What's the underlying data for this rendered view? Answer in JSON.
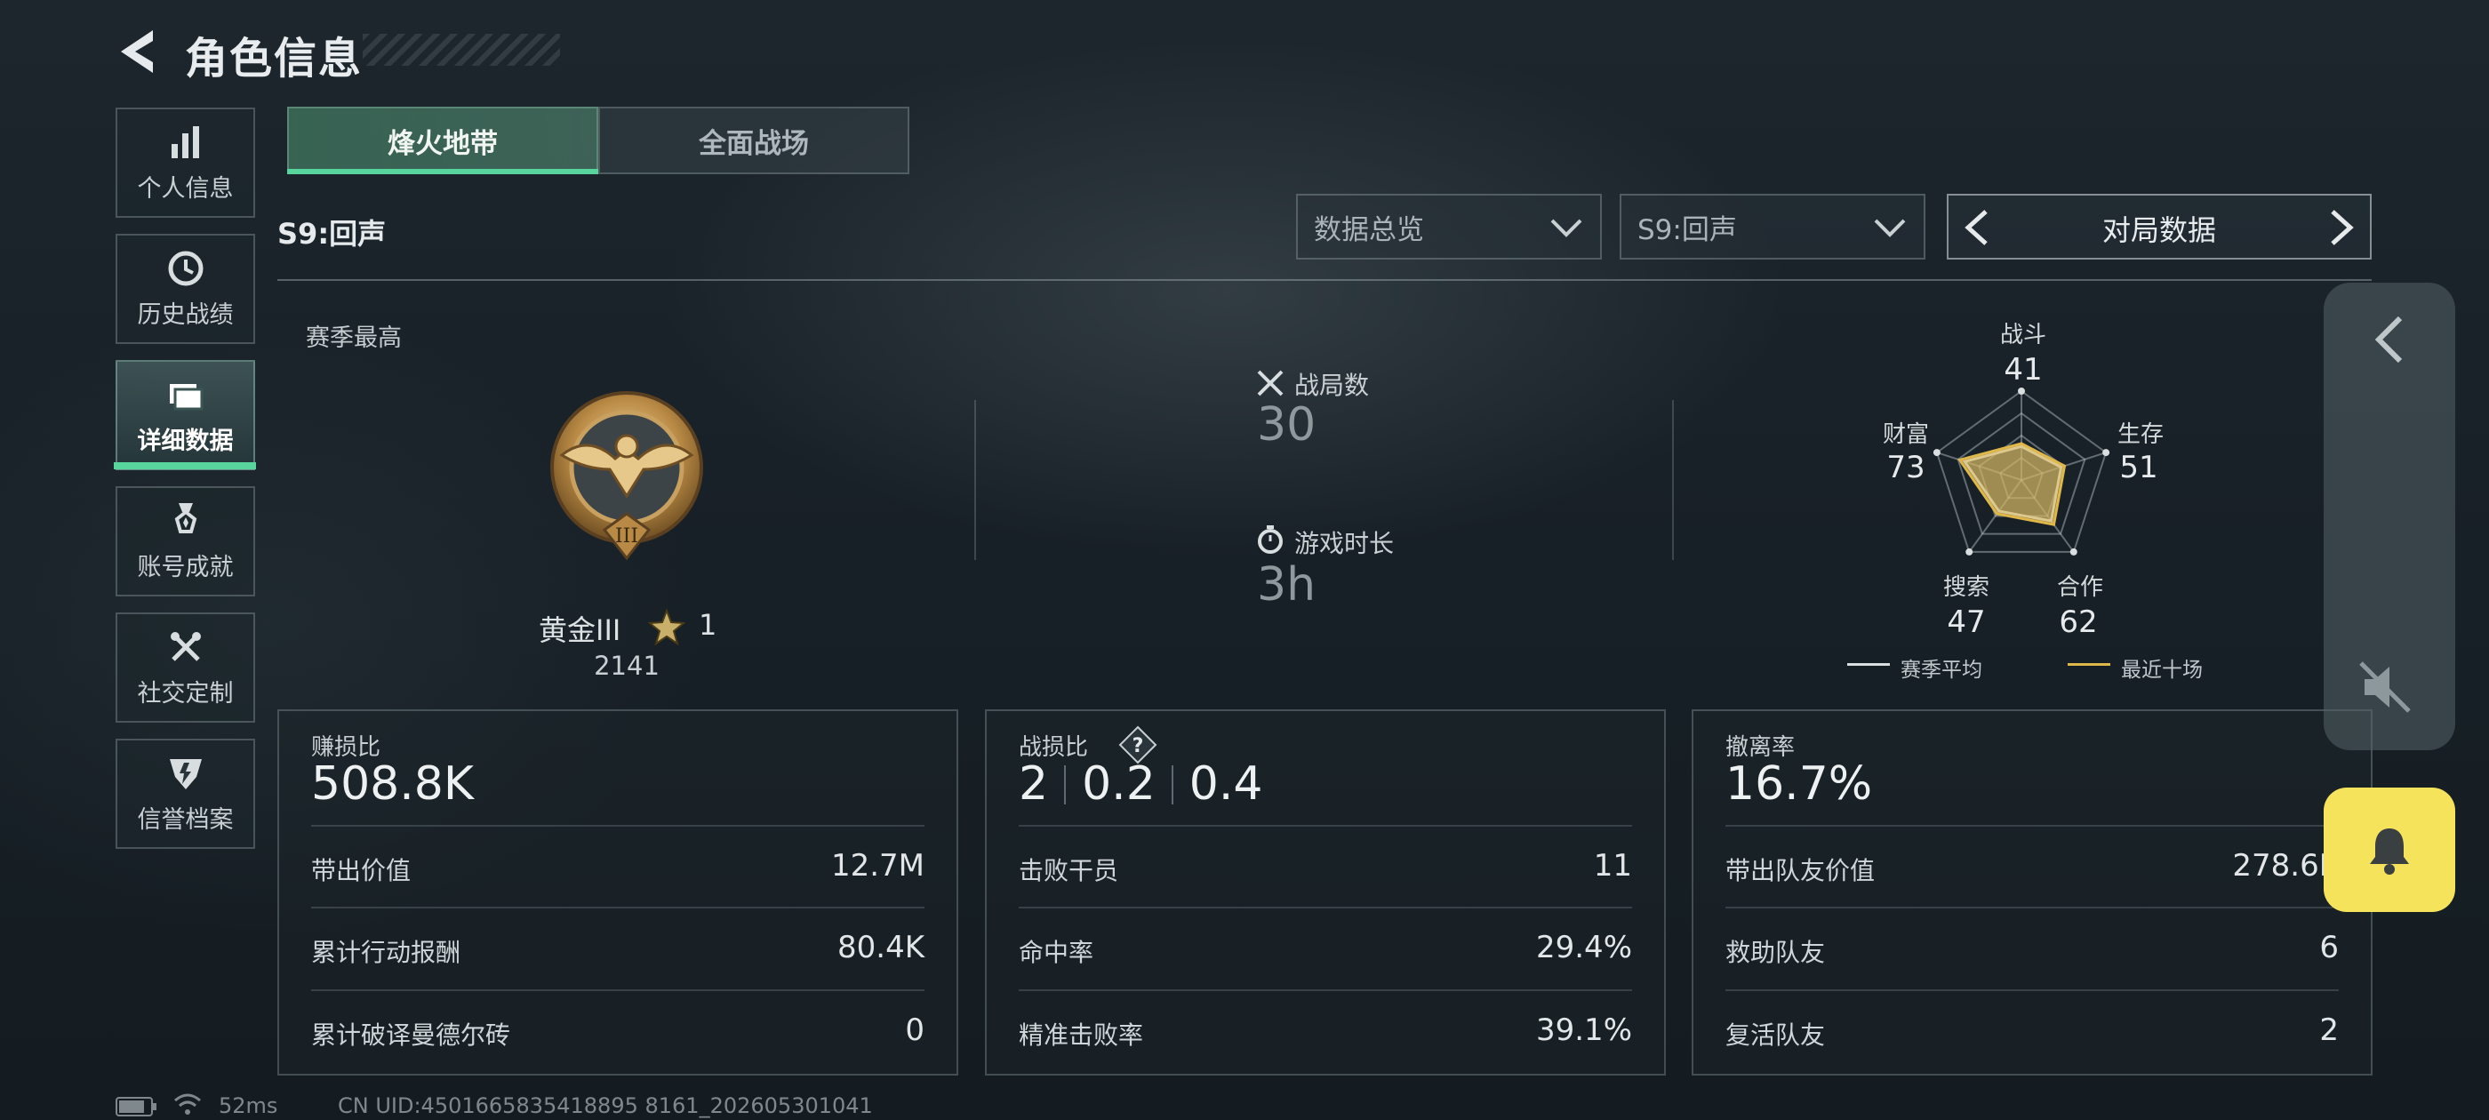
{
  "header": {
    "title": "角色信息"
  },
  "nav": {
    "items": [
      {
        "label": "个人信息",
        "icon": "bar-chart-icon"
      },
      {
        "label": "历史战绩",
        "icon": "clock-history-icon"
      },
      {
        "label": "详细数据",
        "icon": "folder-data-icon",
        "active": true
      },
      {
        "label": "账号成就",
        "icon": "medal-achievement-icon"
      },
      {
        "label": "社交定制",
        "icon": "wrench-tools-icon"
      },
      {
        "label": "信誉档案",
        "icon": "shield-reputation-icon"
      }
    ]
  },
  "tabs": [
    {
      "label": "烽火地带",
      "active": true
    },
    {
      "label": "全面战场",
      "active": false
    }
  ],
  "season_label": "S9:回声",
  "filters": {
    "overview_select": "数据总览",
    "season_select": "S9:回声",
    "pager_label": "对局数据"
  },
  "summary": {
    "peak_label": "赛季最高",
    "rank_name": "黄金III",
    "rank_stars": "1",
    "rank_score": "2141",
    "matches_label": "战局数",
    "matches_value": "30",
    "playtime_label": "游戏时长",
    "playtime_value": "3h"
  },
  "radar": {
    "axes": [
      {
        "label": "战斗",
        "value": "41"
      },
      {
        "label": "生存",
        "value": "51"
      },
      {
        "label": "合作",
        "value": "62"
      },
      {
        "label": "搜索",
        "value": "47"
      },
      {
        "label": "财富",
        "value": "73"
      }
    ],
    "legend_avg": "赛季平均",
    "legend_recent": "最近十场",
    "colors": {
      "avg": "#d9dee0",
      "recent": "#e0b84a"
    }
  },
  "cards": [
    {
      "title": "赚损比",
      "big": "508.8K",
      "rows": [
        {
          "k": "带出价值",
          "v": "12.7M"
        },
        {
          "k": "累计行动报酬",
          "v": "80.4K"
        },
        {
          "k": "累计破译曼德尔砖",
          "v": "0"
        }
      ]
    },
    {
      "title": "战损比",
      "big_parts": [
        "2",
        "0.2",
        "0.4"
      ],
      "rows": [
        {
          "k": "击败干员",
          "v": "11"
        },
        {
          "k": "命中率",
          "v": "29.4%"
        },
        {
          "k": "精准击败率",
          "v": "39.1%"
        }
      ]
    },
    {
      "title": "撤离率",
      "big": "16.7%",
      "rows": [
        {
          "k": "带出队友价值",
          "v": "278.6K"
        },
        {
          "k": "救助队友",
          "v": "6"
        },
        {
          "k": "复活队友",
          "v": "2"
        }
      ]
    }
  ],
  "footer": {
    "ping": "52ms",
    "uid": "CN UID:4501665835418895 8161_202605301041"
  },
  "accent": "#57d59c",
  "bell_color": "#f6e35c"
}
